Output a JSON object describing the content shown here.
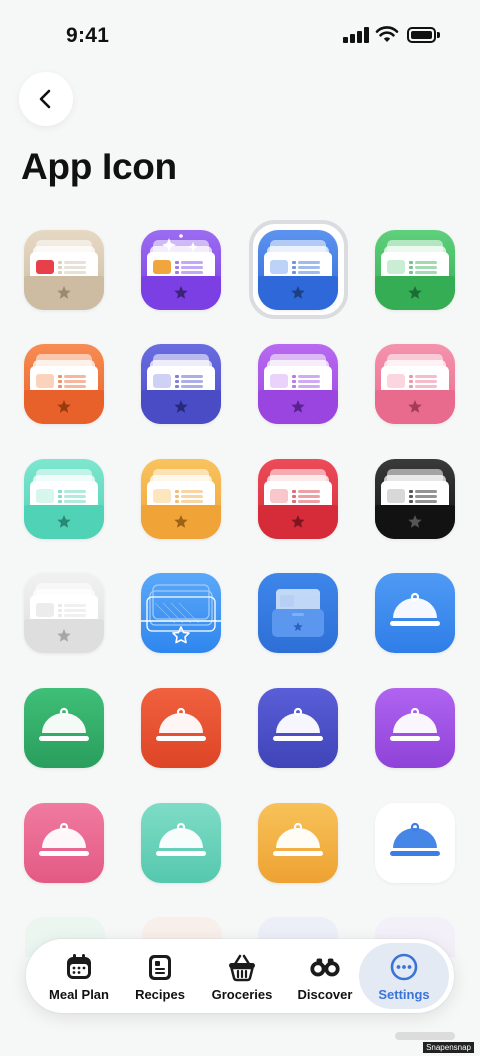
{
  "status_bar": {
    "time": "9:41"
  },
  "header": {
    "title": "App Icon"
  },
  "icons": [
    {
      "style": "drawer",
      "bg1": "#e6d9c4",
      "bg2": "#cdbca1",
      "star": "#9a8a70",
      "accent": "#e7404a",
      "sparkle": false
    },
    {
      "style": "drawer",
      "bg1": "#9b6cf0",
      "bg2": "#7b3fe4",
      "star": "#3b2378",
      "accent": "#f0a53d",
      "sparkle": true
    },
    {
      "style": "drawer",
      "bg1": "#5d93ef",
      "bg2": "#2f68d8",
      "star": "#1d3f84",
      "accent": "#bcd2f6",
      "sparkle": false
    },
    {
      "style": "drawer",
      "bg1": "#5fd07b",
      "bg2": "#34ad55",
      "star": "#1f6b34",
      "accent": "#c9eed3",
      "sparkle": false
    },
    {
      "style": "drawer",
      "bg1": "#f78c53",
      "bg2": "#e8612a",
      "star": "#9a3a12",
      "accent": "#fbd3bd",
      "sparkle": false
    },
    {
      "style": "drawer",
      "bg1": "#6a6ce0",
      "bg2": "#4a4cc6",
      "star": "#272a7a",
      "accent": "#cfd0f6",
      "sparkle": false
    },
    {
      "style": "drawer",
      "bg1": "#b86af0",
      "bg2": "#9a45e0",
      "star": "#5a2290",
      "accent": "#e9d3fa",
      "sparkle": false
    },
    {
      "style": "drawer",
      "bg1": "#f493ad",
      "bg2": "#e86a8c",
      "star": "#a33c59",
      "accent": "#fbd6e1",
      "sparkle": false
    },
    {
      "style": "drawer",
      "bg1": "#7ee6cf",
      "bg2": "#4fd2b5",
      "star": "#2a8773",
      "accent": "#d7f6ee",
      "sparkle": false
    },
    {
      "style": "drawer",
      "bg1": "#f8c35f",
      "bg2": "#f0a336",
      "star": "#9c6316",
      "accent": "#fde6bd",
      "sparkle": false
    },
    {
      "style": "drawer",
      "bg1": "#ec4b58",
      "bg2": "#d62c3a",
      "star": "#7e1520",
      "accent": "#f8c6cb",
      "sparkle": false
    },
    {
      "style": "drawer",
      "bg1": "#3a3a3a",
      "bg2": "#121212",
      "star": "#555",
      "accent": "#d8d8d8",
      "sparkle": false
    },
    {
      "style": "drawer",
      "bg1": "#f1f1f1",
      "bg2": "#dedede",
      "star": "#a6a6a6",
      "accent": "#ececec",
      "sparkle": false
    },
    {
      "style": "wire",
      "bg1": "#5aa8f8",
      "bg2": "#2f86ee",
      "star": "#ffffff",
      "accent": "#9fcbf9",
      "sparkle": false
    },
    {
      "style": "flat",
      "bg1": "#3e86ea",
      "bg2": "#2d6fd6",
      "star": "#2e5fc4",
      "accent": "#e3edfb",
      "sparkle": false
    },
    {
      "style": "cloche",
      "bg1": "#4f9af4",
      "bg2": "#2f7ee8",
      "fg": "#ffffff"
    },
    {
      "style": "cloche",
      "bg1": "#3fbf77",
      "bg2": "#2a9e5e",
      "fg": "#ffffff"
    },
    {
      "style": "cloche",
      "bg1": "#f0613f",
      "bg2": "#dd4526",
      "fg": "#ffffff"
    },
    {
      "style": "cloche",
      "bg1": "#5a5ed8",
      "bg2": "#4044b8",
      "fg": "#ffffff"
    },
    {
      "style": "cloche",
      "bg1": "#b064f0",
      "bg2": "#8f42d8",
      "fg": "#ffffff"
    },
    {
      "style": "cloche",
      "bg1": "#f07aa0",
      "bg2": "#e35a84",
      "fg": "#ffffff"
    },
    {
      "style": "cloche",
      "bg1": "#7fdcc6",
      "bg2": "#55c8ae",
      "fg": "#ffffff"
    },
    {
      "style": "cloche",
      "bg1": "#f7c25a",
      "bg2": "#eea232",
      "fg": "#ffffff"
    },
    {
      "style": "cloche",
      "bg1": "#ffffff",
      "bg2": "#ffffff",
      "fg": "#3b7fe6"
    }
  ],
  "selected_index": 2,
  "tab_bar": {
    "items": [
      {
        "label": "Meal Plan",
        "icon": "calendar-icon"
      },
      {
        "label": "Recipes",
        "icon": "recipe-book-icon"
      },
      {
        "label": "Groceries",
        "icon": "basket-icon"
      },
      {
        "label": "Discover",
        "icon": "binoculars-icon"
      },
      {
        "label": "Settings",
        "icon": "more-circle-icon"
      }
    ],
    "active": "Settings"
  },
  "watermark": "Snapensnap"
}
